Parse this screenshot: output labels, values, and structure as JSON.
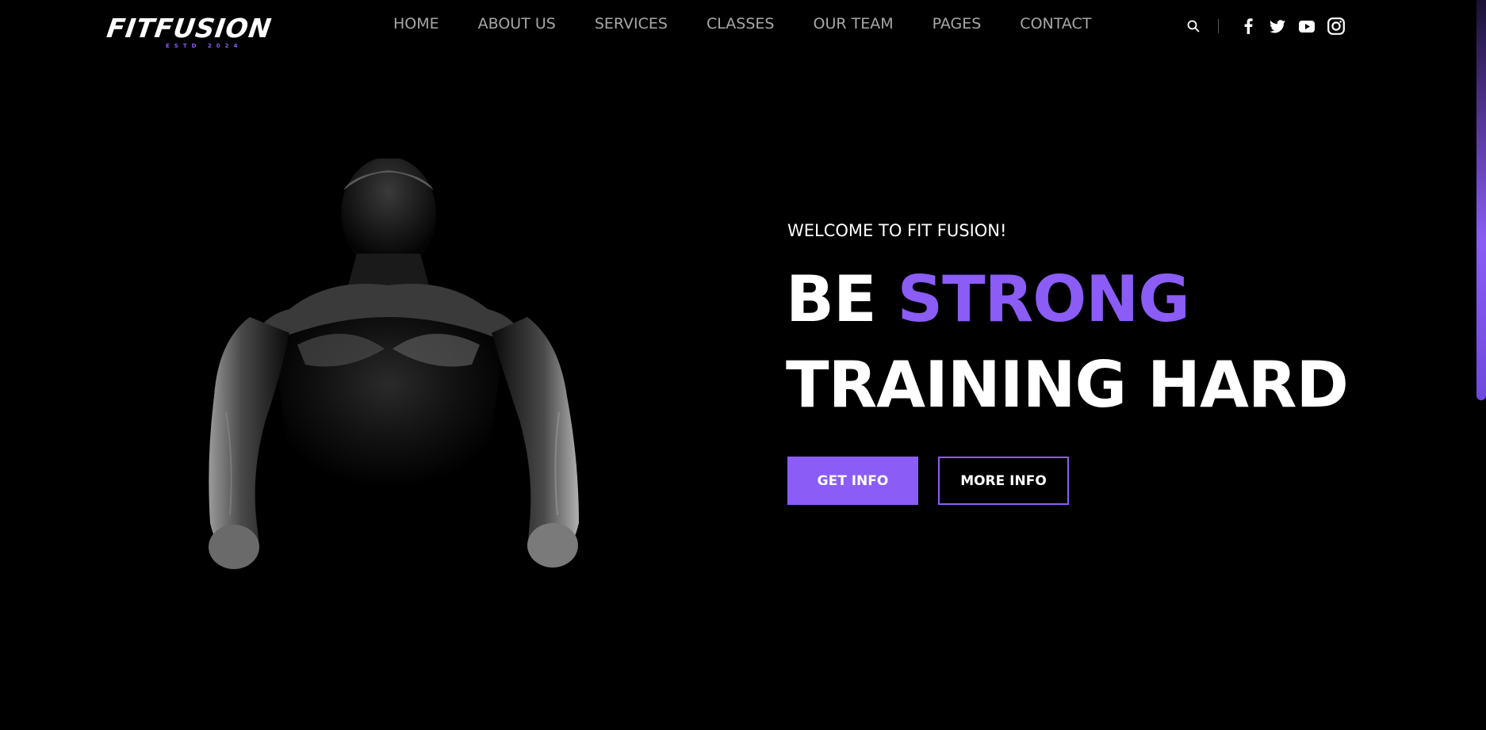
{
  "header": {
    "logo": {
      "brand": "FITFUSION",
      "tagline": "ESTD 2024"
    },
    "nav": [
      {
        "label": "HOME"
      },
      {
        "label": "ABOUT US"
      },
      {
        "label": "SERVICES"
      },
      {
        "label": "CLASSES"
      },
      {
        "label": "OUR TEAM"
      },
      {
        "label": "PAGES"
      },
      {
        "label": "CONTACT"
      }
    ],
    "icons": {
      "search": "search-icon",
      "social": [
        "facebook-icon",
        "twitter-icon",
        "youtube-icon",
        "instagram-icon"
      ]
    }
  },
  "hero": {
    "welcome": "WELCOME TO FIT FUSION!",
    "headline_part1": "BE",
    "headline_accent": "STRONG",
    "headline_line2": "TRAINING HARD",
    "buttons": {
      "primary": "GET INFO",
      "secondary": "MORE INFO"
    }
  },
  "colors": {
    "accent": "#8b5cf6",
    "background": "#000000",
    "nav_text": "#a7a7a7"
  }
}
